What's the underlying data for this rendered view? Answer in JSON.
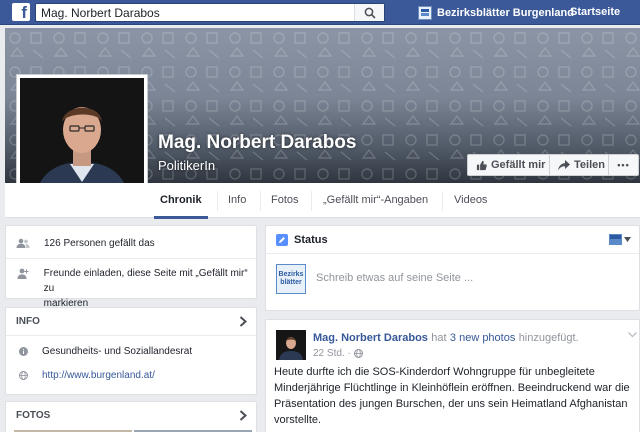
{
  "search": {
    "value": "Mag. Norbert Darabos"
  },
  "topnav": {
    "page_name": "Bezirksblätter Burgenland",
    "home": "Startseite"
  },
  "header": {
    "name": "Mag. Norbert Darabos",
    "category": "PolitikerIn",
    "like_label": "Gefällt mir",
    "share_label": "Teilen",
    "more_label": "•••"
  },
  "tabs": [
    {
      "label": "Chronik"
    },
    {
      "label": "Info"
    },
    {
      "label": "Fotos"
    },
    {
      "label": "„Gefällt mir“-Angaben"
    },
    {
      "label": "Videos"
    }
  ],
  "sidebar": {
    "likes_text": "126 Personen gefällt das",
    "invite_text_1": "Freunde einladen, diese Seite mit „Gefällt mir“ zu",
    "invite_text_2": "markieren",
    "info_title": "INFO",
    "info_items": [
      {
        "text": "Gesundheits- und Soziallandesrat"
      },
      {
        "text": "http://www.burgenland.at/"
      }
    ],
    "photos_title": "FOTOS"
  },
  "composer": {
    "title": "Status",
    "placeholder": "Schreib etwas auf seine Seite ...",
    "avatar_line1": "Bezirks",
    "avatar_line2": "blätter"
  },
  "post": {
    "author": "Mag. Norbert Darabos",
    "verb": "hat",
    "link": "3 new photos",
    "suffix": "hinzugefügt.",
    "time": "22 Std. ·",
    "text_lines": [
      "Heute durfte ich die SOS-Kinderdorf Wohngruppe für unbegleitete",
      "Minderjährige Flüchtlinge in Kleinhöflein eröffnen. Beeindruckend war die",
      "Präsentation des jungen Burschen, der uns sein Heimatland Afghanistan",
      "vorstellte."
    ]
  },
  "colors": {
    "brand": "#3b5998",
    "link": "#365899",
    "page_bg": "#e9ebee"
  }
}
